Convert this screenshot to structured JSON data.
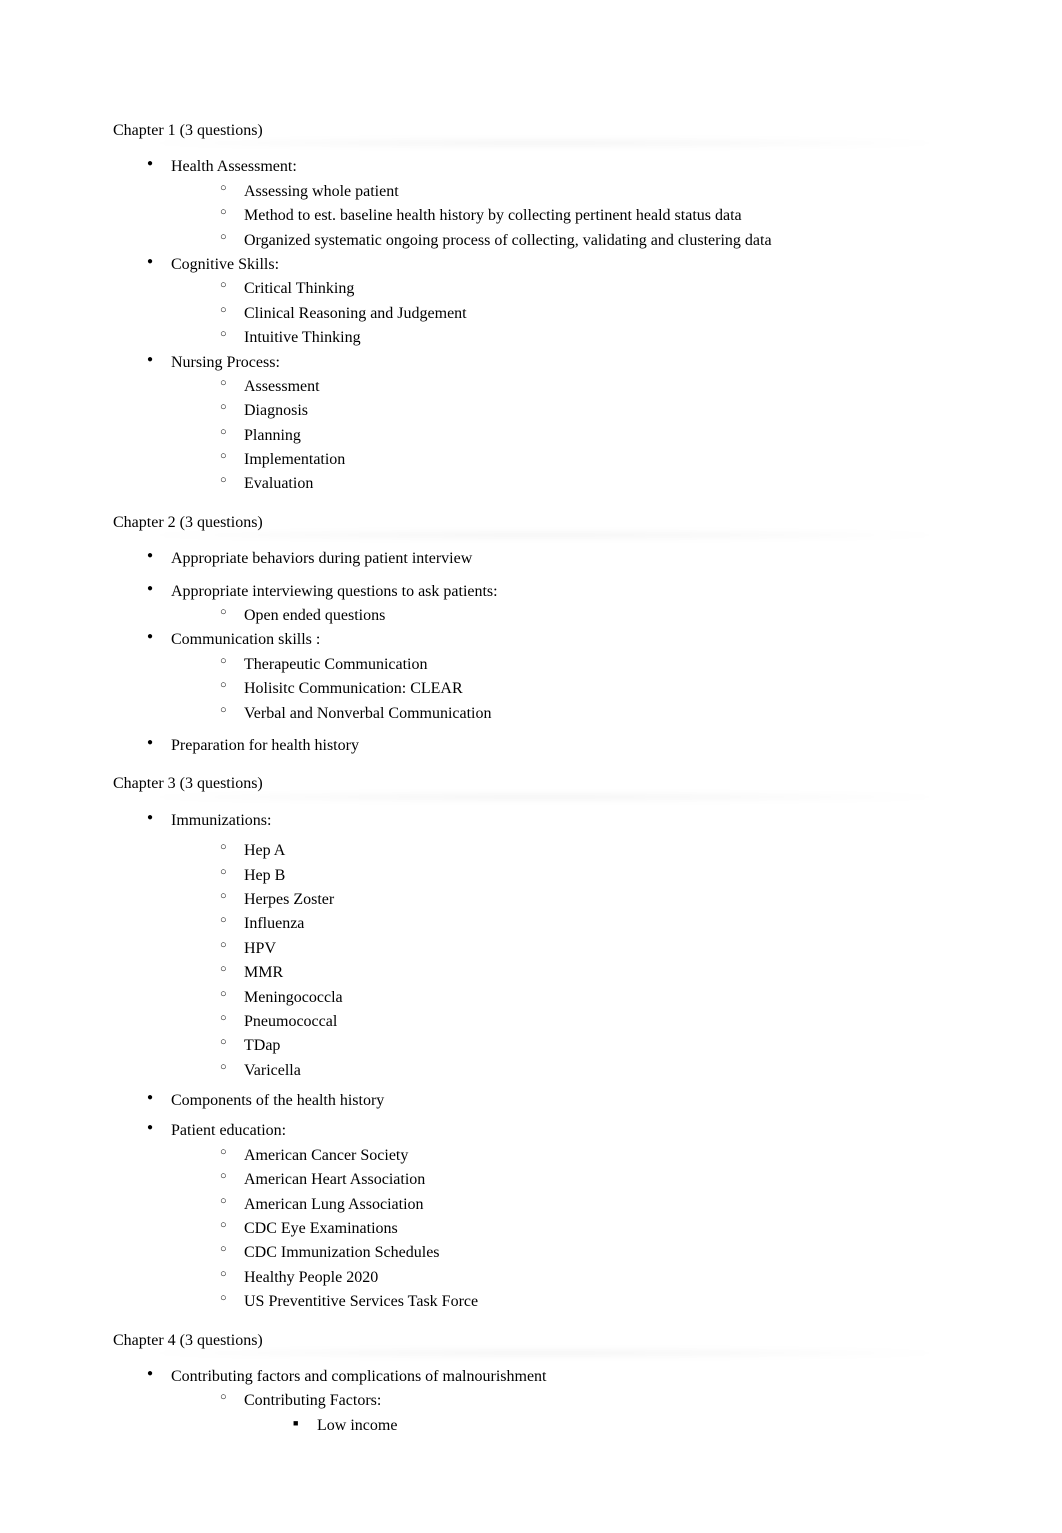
{
  "chapters": [
    {
      "heading": "Chapter 1 (3 questions)",
      "items": [
        {
          "text": "Health Assessment:",
          "children": [
            {
              "text": "Assessing whole patient"
            },
            {
              "text": "Method to est. baseline health history by collecting pertinent heald status data"
            },
            {
              "text": "Organized systematic ongoing process of collecting, validating and clustering data"
            }
          ]
        },
        {
          "text": "Cognitive Skills:",
          "children": [
            {
              "text": "Critical Thinking"
            },
            {
              "text": "Clinical Reasoning and Judgement"
            },
            {
              "text": "Intuitive Thinking"
            }
          ]
        },
        {
          "text": "Nursing Process:",
          "children": [
            {
              "text": "Assessment"
            },
            {
              "text": "Diagnosis"
            },
            {
              "text": "Planning"
            },
            {
              "text": "Implementation"
            },
            {
              "text": "Evaluation"
            }
          ]
        }
      ]
    },
    {
      "heading": "Chapter 2 (3 questions)",
      "items": [
        {
          "text": "Appropriate behaviors during patient interview",
          "spaced": true
        },
        {
          "text": "Appropriate interviewing questions to ask patients:",
          "children": [
            {
              "text": "Open ended questions"
            }
          ]
        },
        {
          "text": "Communication skills       :",
          "children": [
            {
              "text": "Therapeutic Communication"
            },
            {
              "text": "Holisitc Communication: CLEAR"
            },
            {
              "text": "Verbal and Nonverbal Communication"
            }
          ]
        },
        {
          "text": "Preparation for health history",
          "spaced": true
        }
      ]
    },
    {
      "heading": "Chapter 3 (3 questions)",
      "items": [
        {
          "text": "Immunizations:",
          "spaced": true,
          "children": [
            {
              "text": "Hep A"
            },
            {
              "text": "Hep B"
            },
            {
              "text": "Herpes Zoster"
            },
            {
              "text": "Influenza"
            },
            {
              "text": "HPV"
            },
            {
              "text": "MMR"
            },
            {
              "text": "Meningococcla"
            },
            {
              "text": "Pneumococcal"
            },
            {
              "text": "TDap"
            },
            {
              "text": "Varicella"
            }
          ]
        },
        {
          "text": "Components of the health history"
        },
        {
          "text": "Patient education:",
          "spaced": true,
          "children": [
            {
              "text": "American Cancer Society"
            },
            {
              "text": "American Heart Association"
            },
            {
              "text": "American Lung Association"
            },
            {
              "text": "CDC Eye Examinations"
            },
            {
              "text": "CDC Immunization Schedules"
            },
            {
              "text": "Healthy People 2020"
            },
            {
              "text": "US Preventitive Services Task Force"
            }
          ]
        }
      ]
    },
    {
      "heading": "Chapter 4 (3 questions)",
      "items": [
        {
          "text": "Contributing factors and complications of malnourishment",
          "children": [
            {
              "text": "Contributing Factors:",
              "children": [
                {
                  "text": "Low income"
                }
              ]
            }
          ]
        }
      ]
    }
  ]
}
